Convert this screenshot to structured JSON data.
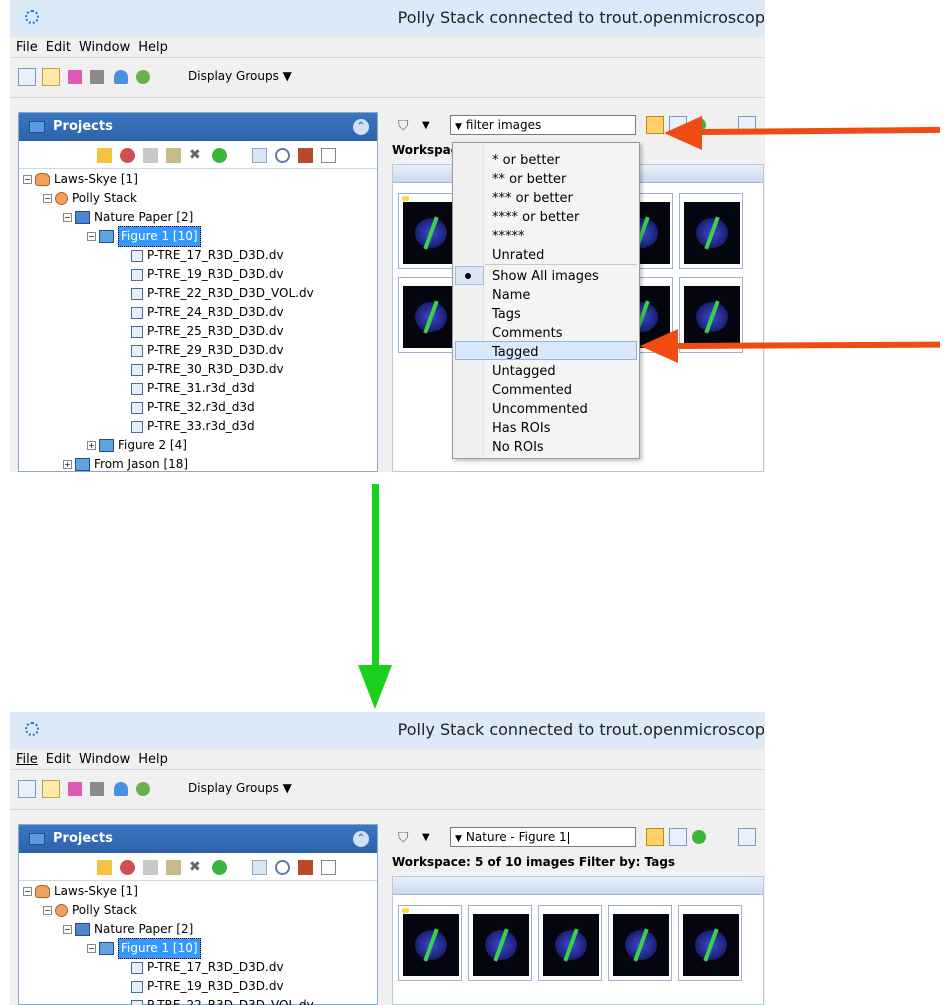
{
  "window": {
    "title": "Polly Stack connected to trout.openmicroscop"
  },
  "menu": [
    "File",
    "Edit",
    "Window",
    "Help"
  ],
  "toolbar": {
    "display_groups_label": "Display Groups"
  },
  "projects_panel": {
    "title": "Projects"
  },
  "tree_top": [
    {
      "label": "Laws-Skye [1]",
      "icon": "users-icon"
    },
    {
      "label": "Polly Stack",
      "icon": "user-icon"
    },
    {
      "label": "Nature Paper [2]",
      "icon": "project-icon"
    },
    {
      "label": "Figure 1 [10]",
      "icon": "dataset-icon"
    },
    {
      "label": "P-TRE_17_R3D_D3D.dv",
      "icon": "image-icon"
    },
    {
      "label": "P-TRE_19_R3D_D3D.dv",
      "icon": "image-icon"
    },
    {
      "label": "P-TRE_22_R3D_D3D_VOL.dv",
      "icon": "image-icon"
    },
    {
      "label": "P-TRE_24_R3D_D3D.dv",
      "icon": "image-icon"
    },
    {
      "label": "P-TRE_25_R3D_D3D.dv",
      "icon": "image-icon"
    },
    {
      "label": "P-TRE_29_R3D_D3D.dv",
      "icon": "image-icon"
    },
    {
      "label": "P-TRE_30_R3D_D3D.dv",
      "icon": "image-icon"
    },
    {
      "label": "P-TRE_31.r3d_d3d",
      "icon": "image-icon"
    },
    {
      "label": "P-TRE_32.r3d_d3d",
      "icon": "image-icon"
    },
    {
      "label": "P-TRE_33.r3d_d3d",
      "icon": "image-icon"
    },
    {
      "label": "Figure 2 [4]",
      "icon": "dataset-icon"
    },
    {
      "label": "From Jason [18]",
      "icon": "dataset-icon"
    }
  ],
  "filter_top": {
    "value": "filter images"
  },
  "workspace_top": {
    "label": "Workspac"
  },
  "dropdown": {
    "rating_items": [
      "* or better",
      "** or better",
      "*** or better",
      "**** or better",
      "*****",
      "Unrated"
    ],
    "filter_items": [
      "Show All images",
      "Name",
      "Tags",
      "Comments",
      "Tagged",
      "Untagged",
      "Commented",
      "Uncommented",
      "Has ROIs",
      "No ROIs"
    ],
    "selected_item": "Show All images",
    "highlighted_item": "Tagged"
  },
  "filter_bottom": {
    "value": "Nature - Figure 1"
  },
  "workspace_bottom": {
    "label": "Workspace: 5 of 10 images   Filter by: Tags"
  },
  "colors": {
    "annotation_arrow": "#f04b12",
    "transition_arrow": "#19d11c",
    "selection": "#3399ff",
    "panel_header": "#2d62a8"
  }
}
